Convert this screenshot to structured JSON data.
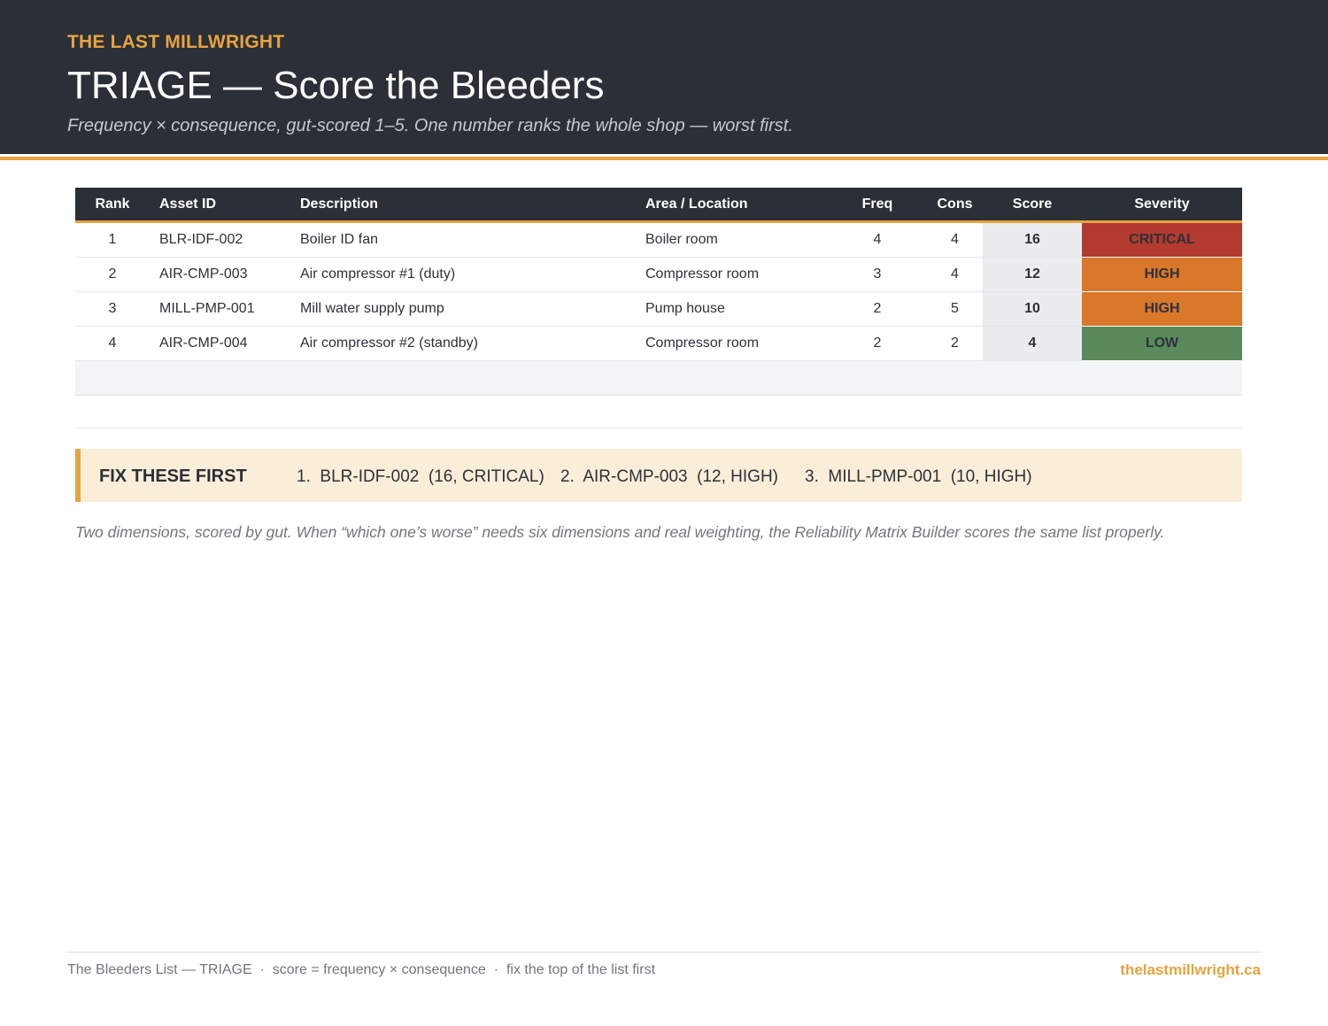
{
  "header": {
    "brand": "THE LAST MILLWRIGHT",
    "title": "TRIAGE — Score the Bleeders",
    "subtitle": "Frequency × consequence, gut-scored 1–5. One number ranks the whole shop — worst first."
  },
  "table": {
    "columns": [
      "Rank",
      "Asset ID",
      "Description",
      "Area / Location",
      "Freq",
      "Cons",
      "Score",
      "Severity"
    ],
    "rows": [
      {
        "rank": "1",
        "asset_id": "BLR-IDF-002",
        "description": "Boiler ID fan",
        "area": "Boiler room",
        "freq": "4",
        "cons": "4",
        "score": "16",
        "severity": "CRITICAL"
      },
      {
        "rank": "2",
        "asset_id": "AIR-CMP-003",
        "description": "Air compressor #1 (duty)",
        "area": "Compressor room",
        "freq": "3",
        "cons": "4",
        "score": "12",
        "severity": "HIGH"
      },
      {
        "rank": "3",
        "asset_id": "MILL-PMP-001",
        "description": "Mill water supply pump",
        "area": "Pump house",
        "freq": "2",
        "cons": "5",
        "score": "10",
        "severity": "HIGH"
      },
      {
        "rank": "4",
        "asset_id": "AIR-CMP-004",
        "description": "Air compressor #2 (standby)",
        "area": "Compressor room",
        "freq": "2",
        "cons": "2",
        "score": "4",
        "severity": "LOW"
      }
    ]
  },
  "severity_colors": {
    "CRITICAL": "#b33a2e",
    "HIGH": "#d9772b",
    "LOW": "#5a8a5c"
  },
  "fix_first": {
    "label": "FIX THESE FIRST",
    "items": [
      "1.  BLR-IDF-002  (16, CRITICAL)",
      "2.  AIR-CMP-003  (12, HIGH)",
      "3.  MILL-PMP-001  (10, HIGH)"
    ]
  },
  "note": "Two dimensions, scored by gut. When “which one’s worse” needs six dimensions and real weighting, the Reliability Matrix Builder scores the same list properly.",
  "footer": {
    "left": "The Bleeders List — TRIAGE  ·  score = frequency × consequence  ·  fix the top of the list first",
    "right": "thelastmillwright.ca"
  },
  "colors": {
    "header_bg": "#2b2f37",
    "accent": "#e7a33e",
    "callout_bg": "#fbeed9"
  }
}
